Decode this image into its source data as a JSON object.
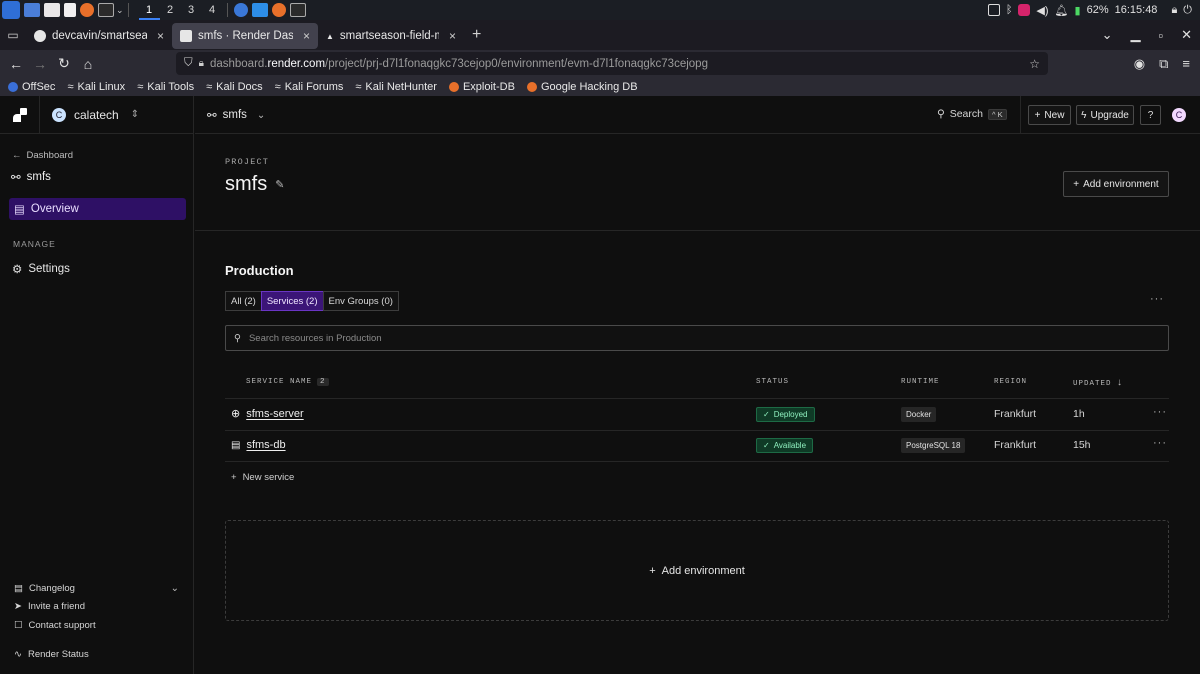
{
  "taskbar": {
    "workspaces": [
      "1",
      "2",
      "3",
      "4"
    ],
    "battery": "62%",
    "clock": "16:15:48"
  },
  "browser": {
    "tabs": [
      {
        "title": "devcavin/smartseason-fi",
        "close": "×"
      },
      {
        "title": "smfs · Render Dashboa",
        "close": "×"
      },
      {
        "title": "smartseason-field-monit",
        "close": "×"
      }
    ],
    "new_tab": "+",
    "url_prefix": "dashboard.",
    "url_host": "render.com",
    "url_path": "/project/prj-d7l1fonaqgkc73cejop0/environment/evm-d7l1fonaqgkc73cejopg",
    "bookmarks": [
      "OffSec",
      "Kali Linux",
      "Kali Tools",
      "Kali Docs",
      "Kali Forums",
      "Kali NetHunter",
      "Exploit-DB",
      "Google Hacking DB"
    ]
  },
  "sidebar": {
    "workspace": "calatech",
    "workspace_avatar": "C",
    "back_label": "Dashboard",
    "project_name": "smfs",
    "overview_label": "Overview",
    "manage_heading": "MANAGE",
    "settings_label": "Settings",
    "changelog_label": "Changelog",
    "invite_label": "Invite a friend",
    "support_label": "Contact support",
    "status_label": "Render Status"
  },
  "header": {
    "project": "smfs",
    "search_label": "Search",
    "search_shortcut": "^ K",
    "new_label": "New",
    "upgrade_label": "Upgrade",
    "user_avatar": "C"
  },
  "project": {
    "eyebrow": "PROJECT",
    "name": "smfs",
    "add_env_label": "Add environment"
  },
  "environment": {
    "title": "Production",
    "filters": [
      {
        "label": "All (2)",
        "active": false
      },
      {
        "label": "Services (2)",
        "active": true
      },
      {
        "label": "Env Groups (0)",
        "active": false
      }
    ],
    "search_placeholder": "Search resources in Production",
    "columns": {
      "name": "SERVICE NAME",
      "name_count": "2",
      "status": "STATUS",
      "runtime": "RUNTIME",
      "region": "REGION",
      "updated": "UPDATED"
    },
    "rows": [
      {
        "icon": "globe-icon",
        "name": "sfms-server",
        "status": "Deployed",
        "runtime": "Docker",
        "region": "Frankfurt",
        "updated": "1h"
      },
      {
        "icon": "database-icon",
        "name": "sfms-db",
        "status": "Available",
        "runtime": "PostgreSQL 18",
        "region": "Frankfurt",
        "updated": "15h"
      }
    ],
    "new_service_label": "New service"
  },
  "add_environment_box": "Add environment",
  "colors": {
    "accent_purple": "#2e1065",
    "status_green": "#8ff0bf",
    "background": "#0f0f0f"
  }
}
